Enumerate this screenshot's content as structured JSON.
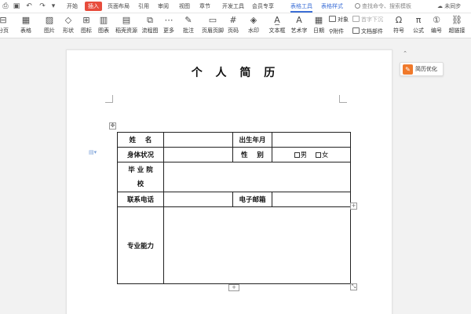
{
  "tabs": {
    "menu": "开始",
    "insert": "插入",
    "layout": "页面布局",
    "reference": "引用",
    "review": "审阅",
    "view": "视图",
    "chapter": "章节",
    "dev": "开发工具",
    "member": "会员专享",
    "table_tools": "表格工具",
    "table_style": "表格样式"
  },
  "search": {
    "placeholder": "查找命令、搜索模板"
  },
  "sync": {
    "label": "未同步"
  },
  "ribbon": {
    "page": "分页",
    "table": "表格",
    "picture": "图片",
    "shape": "形状",
    "icon": "图标",
    "chart": "图表",
    "stock_resource": "稻壳资源",
    "flowchart": "流程图",
    "more": "更多",
    "comment": "批注",
    "header_footer": "页眉页脚",
    "page_number": "页码",
    "watermark": "水印",
    "textbox": "文本框",
    "art_text": "艺术字",
    "date": "日期",
    "object": "对象",
    "attachment": "附件",
    "first_drop": "首字下沉",
    "doc_parts": "文档部件",
    "symbol": "符号",
    "formula": "公式",
    "numbering": "编号",
    "hyperlink": "超链接"
  },
  "document": {
    "title": "个 人 简 历",
    "table": {
      "name": "姓    名",
      "birth": "出生年月",
      "health": "身体状况",
      "gender": "性    别",
      "male": "男",
      "female": "女",
      "school_line1": "毕 业 院",
      "school_line2": "校",
      "phone": "联系电话",
      "email": "电子邮箱",
      "skills": "专业能力"
    }
  },
  "side_panel": {
    "resume_optimize": "简历优化"
  },
  "colors": {
    "accent": "#e74c3c",
    "context_tab": "#3c6fd6",
    "resume_badge": "#f0792b"
  }
}
